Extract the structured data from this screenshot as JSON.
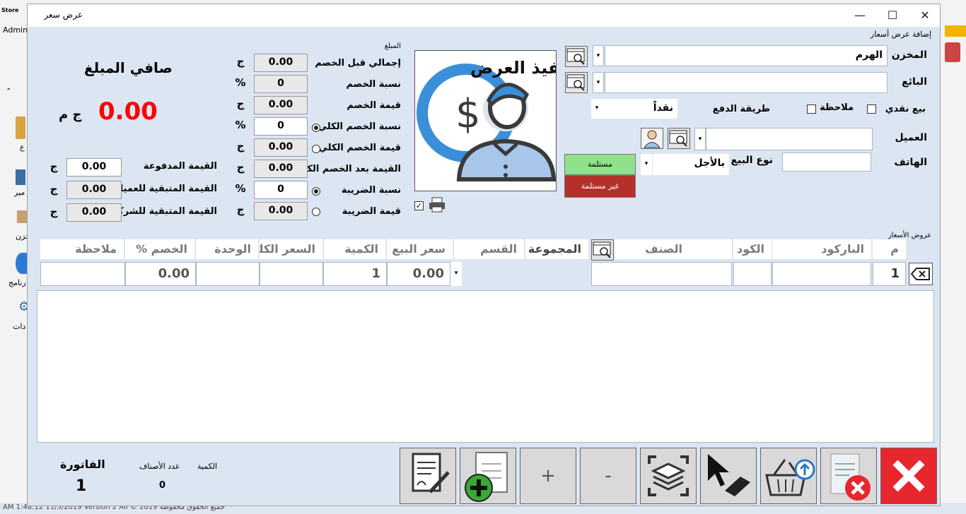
{
  "window": {
    "title": "عرض سعر",
    "close": "✕",
    "maximize": "☐",
    "minimize": "—"
  },
  "background": {
    "admin": "Admin",
    "side1": "ع",
    "side2": "مير",
    "side3": "خزن",
    "side4": "رنامج",
    "side5": "دات",
    "status": "AM 1:48:12 11/5/2019   Version 2   All © 2019   جميع الحقوق محفوظة"
  },
  "header": {
    "add_label": "إضافة عرض أسعار"
  },
  "form": {
    "warehouse_label": "المخزن",
    "warehouse_value": "الهرم",
    "seller_label": "البائع",
    "seller_value": "",
    "payment_label": "طريقة الدفع",
    "payment_value": "نقداً",
    "note_label": "ملاحظة",
    "cash_sale_label": "بيع نقدي",
    "client_label": "العميل",
    "client_value": "",
    "phone_label": "الهاتف",
    "phone_value": "",
    "sale_type_label": "نوع البيع",
    "sale_type_value": "بالأجل",
    "received_label": "مستلمة",
    "not_received_label": "غير مستلمة",
    "offer_image_text": "تنفيذ العرض"
  },
  "totals": {
    "amount_caption": "المبلغ",
    "rows": [
      {
        "label": "إجمالي قبل الخصم",
        "value": "0.00",
        "unit": "ج"
      },
      {
        "label": "نسبة الخصم",
        "value": "0",
        "unit": "%"
      },
      {
        "label": "قيمة الخصم",
        "value": "0.00",
        "unit": "ج"
      },
      {
        "label": "نسبة الخصم الكلي",
        "value": "0",
        "unit": "%"
      },
      {
        "label": "قيمة الخصم الكلي",
        "value": "0.00",
        "unit": "ج"
      },
      {
        "label": "القيمة بعد الخصم الكلى",
        "value": "0.00",
        "unit": "ج"
      },
      {
        "label": "نسبة الضريبة",
        "value": "0",
        "unit": "%"
      },
      {
        "label": "قيمة الضريبة",
        "value": "0.00",
        "unit": "ج"
      }
    ],
    "net_label": "صافي المبلغ",
    "net_value": "0.00",
    "net_currency": "ج م",
    "paid_label": "القيمة المدفوعة",
    "paid_value": "0.00",
    "remain_client_label": "القيمة المتبقية للعميل",
    "remain_client_value": "0.00",
    "remain_company_label": "القيمة المتبقية للشركة",
    "remain_company_value": "0.00",
    "currency": "ج"
  },
  "grid": {
    "section_label": "عروض الأسعار",
    "headers": {
      "m": "م",
      "barcode": "الباركود",
      "code": "الكود",
      "item": "الصنف",
      "group": "المجموعة",
      "section": "القسم",
      "sale_price": "سعر البيع",
      "qty": "الكمية",
      "total_price": "السعر الكلي",
      "unit": "الوحدة",
      "discount": "الخصم %",
      "notes": "ملاحظة"
    },
    "entry": {
      "m": "1",
      "sale_price": "0.00",
      "qty": "1",
      "discount": "0.00"
    }
  },
  "footer": {
    "invoice_label": "الفاتورة",
    "invoice_value": "1",
    "items_count_label": "عدد الأصناف",
    "items_count_value": "0",
    "qty_label": "الكمية"
  },
  "buttons": {
    "plus": "+",
    "minus": "-"
  },
  "colors": {
    "received": "#8fe08a",
    "not_received": "#b3302b",
    "net_value": "#ff0000",
    "close_red": "#e8262e"
  }
}
